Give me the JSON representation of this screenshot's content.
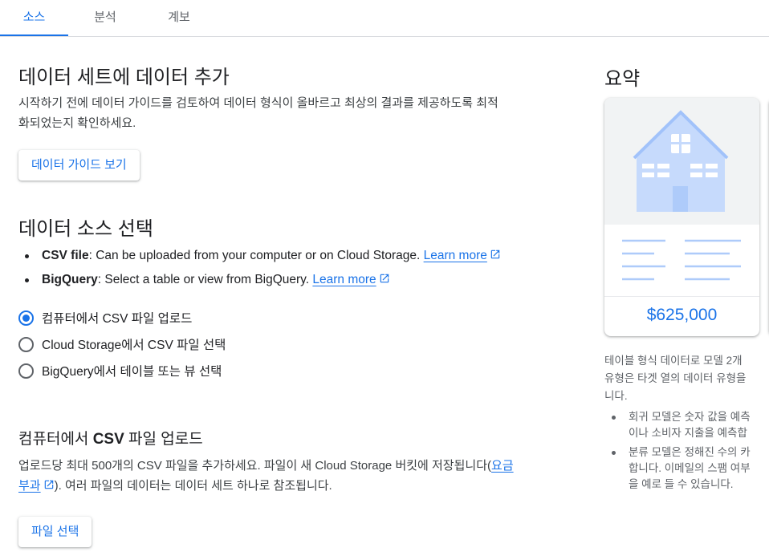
{
  "tabs": [
    {
      "label": "소스",
      "active": true
    },
    {
      "label": "분석",
      "active": false
    },
    {
      "label": "계보",
      "active": false
    }
  ],
  "add_data": {
    "title": "데이터 세트에 데이터 추가",
    "description_line1": "시작하기 전에 데이터 가이드를 검토하여 데이터 형식이 올바르고 최상의 결과를 제공하도록 최적",
    "description_line2": "화되었는지 확인하세요.",
    "guide_button": "데이터 가이드 보기"
  },
  "source_select": {
    "title": "데이터 소스 선택",
    "bullets": [
      {
        "bold": "CSV file",
        "text": ": Can be uploaded from your computer or on Cloud Storage. ",
        "link": "Learn more"
      },
      {
        "bold": "BigQuery",
        "text": ": Select a table or view from BigQuery. ",
        "link": "Learn more"
      }
    ],
    "options": [
      {
        "label": "컴퓨터에서 CSV 파일 업로드",
        "selected": true
      },
      {
        "label": "Cloud Storage에서 CSV 파일 선택",
        "selected": false
      },
      {
        "label": "BigQuery에서 테이블 또는 뷰 선택",
        "selected": false
      }
    ]
  },
  "upload": {
    "title_pre": "컴퓨터에서 ",
    "title_bold": "CSV",
    "title_post": " 파일 업로드",
    "text_line1_pre": "업로드당 최대 500개의 CSV 파일을 추가하세요. 파일이 새 Cloud Storage 버킷에 저장됩니다(",
    "link_part1": "요금",
    "link_part2": "부과",
    "text_line2_post": "). 여러 파일의 데이터는 데이터 세트 하나로 참조됩니다.",
    "select_button": "파일 선택"
  },
  "summary": {
    "title": "요약",
    "price": "$625,000",
    "text_lines": [
      "테이블 형식 데이터로 모델 2개",
      "유형은 타겟 열의 데이터 유형을",
      "니다."
    ],
    "list": [
      {
        "line1": "회귀 모델은 숫자 값을 예측",
        "line2": "이나 소비자 지출을 예측합"
      },
      {
        "line1": "분류 모델은 정해진 수의 카",
        "line2": "합니다. 이메일의 스팸 여부",
        "line3": "을 예로 들 수 있습니다."
      }
    ]
  },
  "colors": {
    "accent": "#1a73e8",
    "house": "#aecbfa",
    "text": "#202124",
    "muted": "#5f6368"
  }
}
